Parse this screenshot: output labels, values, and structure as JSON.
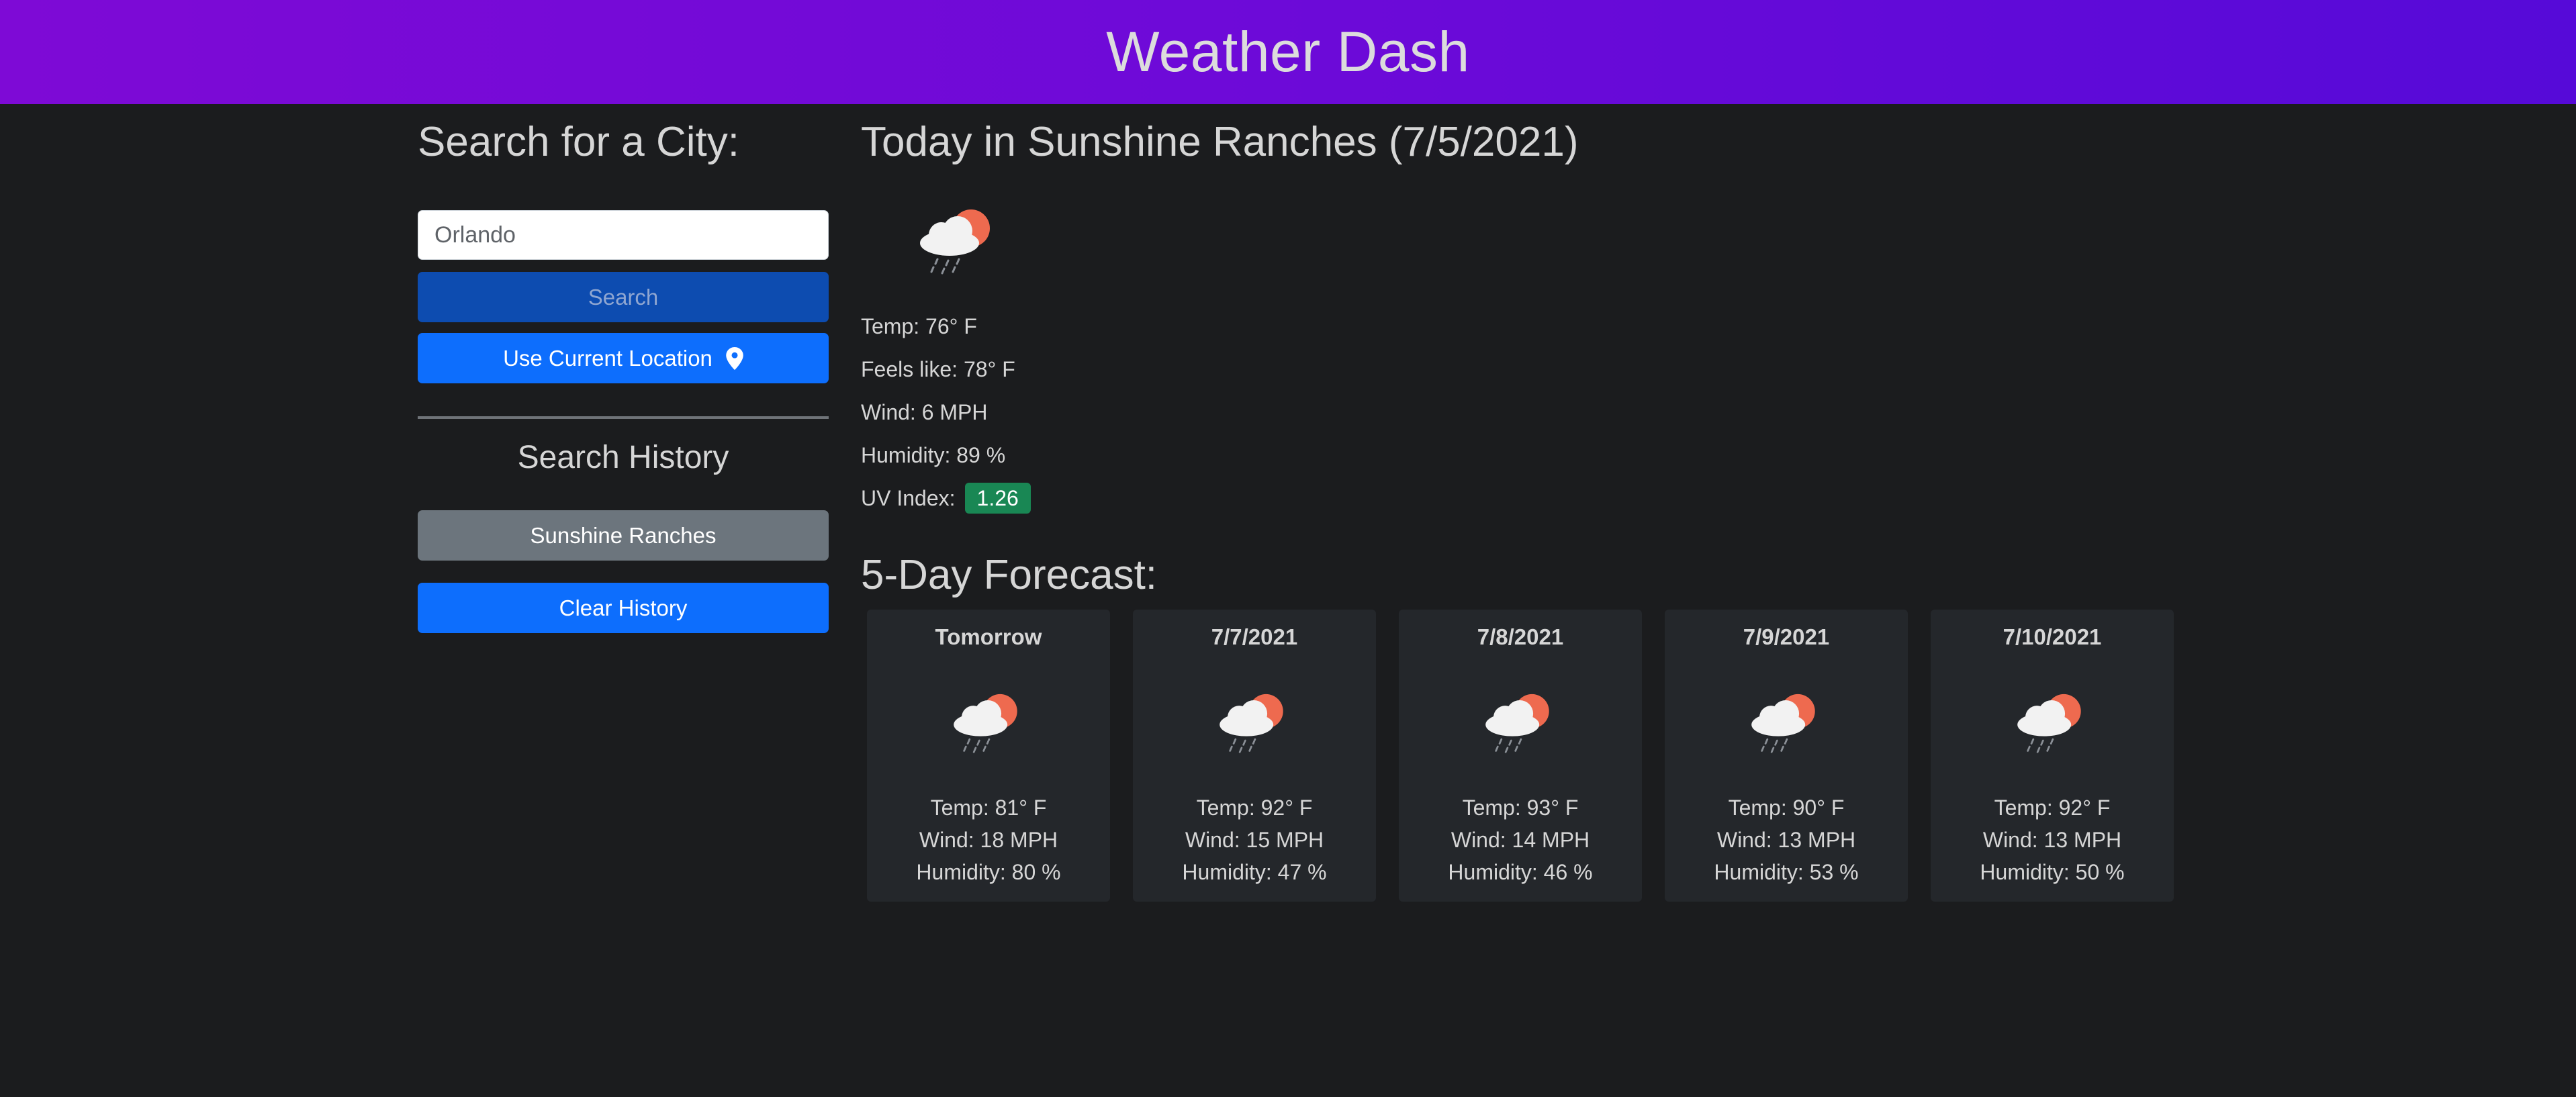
{
  "app": {
    "title": "Weather Dash"
  },
  "search": {
    "heading": "Search for a City:",
    "input_value": "Orlando",
    "search_label": "Search",
    "location_label": "Use Current Location"
  },
  "history": {
    "heading": "Search History",
    "items": [
      "Sunshine Ranches"
    ],
    "clear_label": "Clear History"
  },
  "today": {
    "heading": "Today in Sunshine Ranches (7/5/2021)",
    "icon": "rain-cloud-sun-icon",
    "temp": "Temp: 76° F",
    "feels": "Feels like: 78° F",
    "wind": "Wind: 6 MPH",
    "humidity": "Humidity: 89 %",
    "uv_label": "UV Index:",
    "uv_value": "1.26"
  },
  "forecast": {
    "heading": "5-Day Forecast:",
    "days": [
      {
        "date": "Tomorrow",
        "temp": "Temp: 81° F",
        "wind": "Wind: 18 MPH",
        "humidity": "Humidity: 80 %",
        "icon": "rain-cloud-sun-icon"
      },
      {
        "date": "7/7/2021",
        "temp": "Temp: 92° F",
        "wind": "Wind: 15 MPH",
        "humidity": "Humidity: 47 %",
        "icon": "rain-cloud-sun-icon"
      },
      {
        "date": "7/8/2021",
        "temp": "Temp: 93° F",
        "wind": "Wind: 14 MPH",
        "humidity": "Humidity: 46 %",
        "icon": "rain-cloud-sun-icon"
      },
      {
        "date": "7/9/2021",
        "temp": "Temp: 90° F",
        "wind": "Wind: 13 MPH",
        "humidity": "Humidity: 53 %",
        "icon": "rain-cloud-sun-icon"
      },
      {
        "date": "7/10/2021",
        "temp": "Temp: 92° F",
        "wind": "Wind: 13 MPH",
        "humidity": "Humidity: 50 %",
        "icon": "rain-cloud-sun-icon"
      }
    ]
  },
  "colors": {
    "header_start": "#7e0ad6",
    "header_end": "#560ad8",
    "background": "#1b1c1e",
    "primary": "#0d6efd",
    "uv_low": "#198754",
    "card": "#24272b"
  }
}
